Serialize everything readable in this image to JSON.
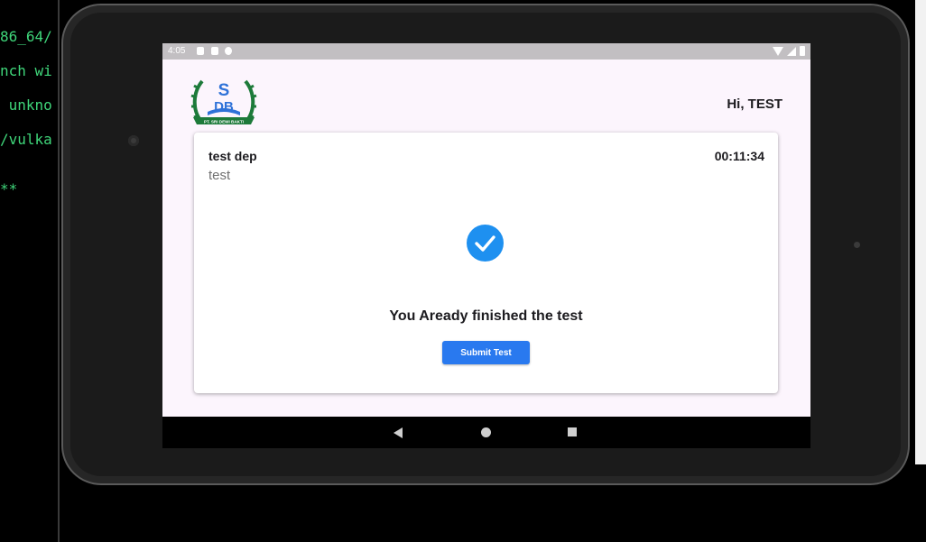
{
  "terminal": {
    "lines": [
      "86_64/",
      "nch wi",
      " unkno",
      "/vulka",
      "**"
    ]
  },
  "status_bar": {
    "time": "4:05"
  },
  "header": {
    "logo_caption": "PT. SRI DEWI BAKTI",
    "greeting": "Hi, TEST"
  },
  "test_card": {
    "title": "test dep",
    "subtitle": "test",
    "timer": "00:11:34",
    "status_icon": "check-circle-icon",
    "message": "You Aready finished the test",
    "submit_label": "Submit Test"
  },
  "colors": {
    "accent": "#2979ef",
    "check": "#1e90f0",
    "screen_bg": "#fcf5fd",
    "logo_green": "#1d7a3a",
    "logo_blue": "#2f72d8",
    "terminal_green": "#3fd67a"
  }
}
